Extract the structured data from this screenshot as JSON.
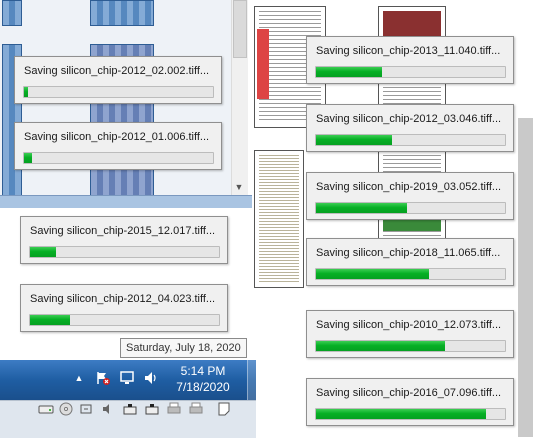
{
  "dialogs": [
    {
      "title": "Saving silicon_chip-2012_02.002.tiff...",
      "progress": 0.02
    },
    {
      "title": "Saving silicon_chip-2012_01.006.tiff...",
      "progress": 0.04
    },
    {
      "title": "Saving silicon_chip-2015_12.017.tiff...",
      "progress": 0.14
    },
    {
      "title": "Saving silicon_chip-2012_04.023.tiff...",
      "progress": 0.21
    },
    {
      "title": "Saving silicon_chip-2013_11.040.tiff...",
      "progress": 0.35
    },
    {
      "title": "Saving silicon_chip-2012_03.046.tiff...",
      "progress": 0.4
    },
    {
      "title": "Saving silicon_chip-2019_03.052.tiff...",
      "progress": 0.48
    },
    {
      "title": "Saving silicon_chip-2018_11.065.tiff...",
      "progress": 0.6
    },
    {
      "title": "Saving silicon_chip-2010_12.073.tiff...",
      "progress": 0.68
    },
    {
      "title": "Saving silicon_chip-2016_07.096.tiff...",
      "progress": 0.9
    }
  ],
  "taskbar": {
    "time": "5:14 PM",
    "date": "7/18/2020",
    "tooltip": "Saturday, July 18, 2020",
    "tray_icons": [
      "show-hidden-icons-arrow",
      "action-center-flag-icon",
      "network-icon",
      "volume-icon"
    ]
  },
  "statusbar_icons": [
    "hard-disk-icon",
    "optical-drive-icon",
    "usb-icon",
    "audio-icon",
    "network-adapter-icon",
    "network-adapter-icon",
    "printer-icon",
    "printer-icon",
    "notes-icon"
  ],
  "colors": {
    "progress_green": "#06b025",
    "taskbar_blue": "#1f5ea3",
    "dialog_bg": "#f0f0f0"
  }
}
